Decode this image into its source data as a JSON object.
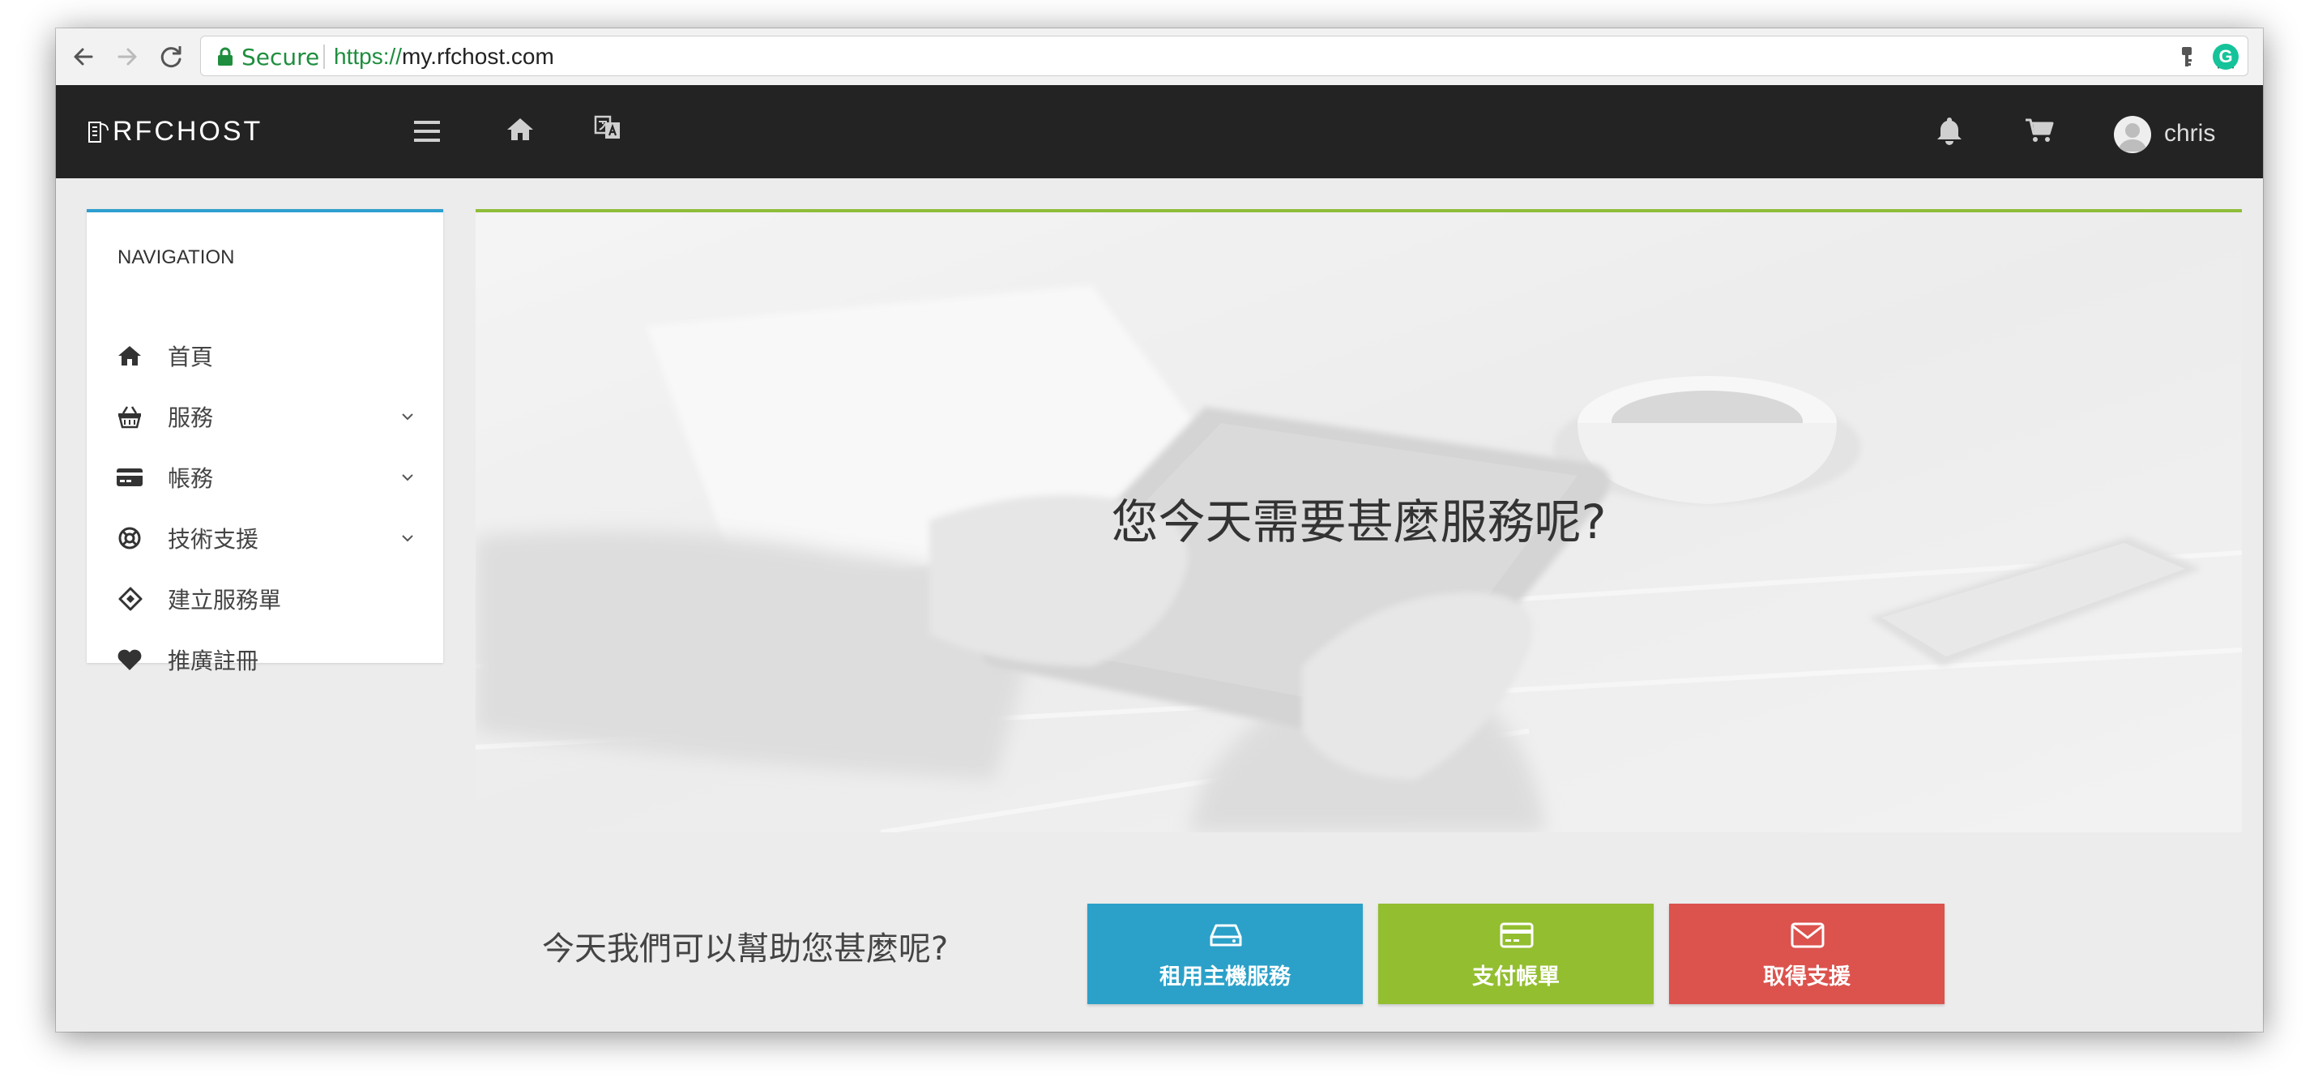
{
  "browser": {
    "secure_label": "Secure",
    "url_scheme": "https://",
    "url_host": "my.rfchost.com",
    "icons": [
      "back-icon",
      "forward-icon",
      "reload-icon",
      "lock-icon",
      "key-icon",
      "star-icon",
      "grammarly-icon"
    ],
    "grammarly_letter": "G"
  },
  "header": {
    "logo_text": "RFCHOST",
    "username": "chris",
    "icons": [
      "menu-icon",
      "home-icon",
      "translate-icon",
      "bell-icon",
      "cart-icon",
      "avatar"
    ]
  },
  "sidebar": {
    "title": "NAVIGATION",
    "items": [
      {
        "label": "首頁",
        "icon": "home-icon",
        "has_submenu": false
      },
      {
        "label": "服務",
        "icon": "basket-icon",
        "has_submenu": true
      },
      {
        "label": "帳務",
        "icon": "credit-card-icon",
        "has_submenu": true
      },
      {
        "label": "技術支援",
        "icon": "life-ring-icon",
        "has_submenu": true
      },
      {
        "label": "建立服務單",
        "icon": "ticket-icon",
        "has_submenu": false
      },
      {
        "label": "推廣註冊",
        "icon": "heart-icon",
        "has_submenu": false
      }
    ]
  },
  "hero": {
    "title": "您今天需要甚麼服務呢?"
  },
  "help": {
    "text": "今天我們可以幫助您甚麼呢?",
    "buttons": [
      {
        "label": "租用主機服務",
        "icon": "hdd-icon",
        "color": "#2ba1c9"
      },
      {
        "label": "支付帳單",
        "icon": "credit-card-icon",
        "color": "#93be30"
      },
      {
        "label": "取得支援",
        "icon": "envelope-icon",
        "color": "#dc524d"
      }
    ]
  },
  "colors": {
    "header_bg": "#232323",
    "sidebar_accent": "#2e9fd0",
    "hero_accent": "#8fbd3a",
    "secure_green": "#1e8e3e"
  }
}
